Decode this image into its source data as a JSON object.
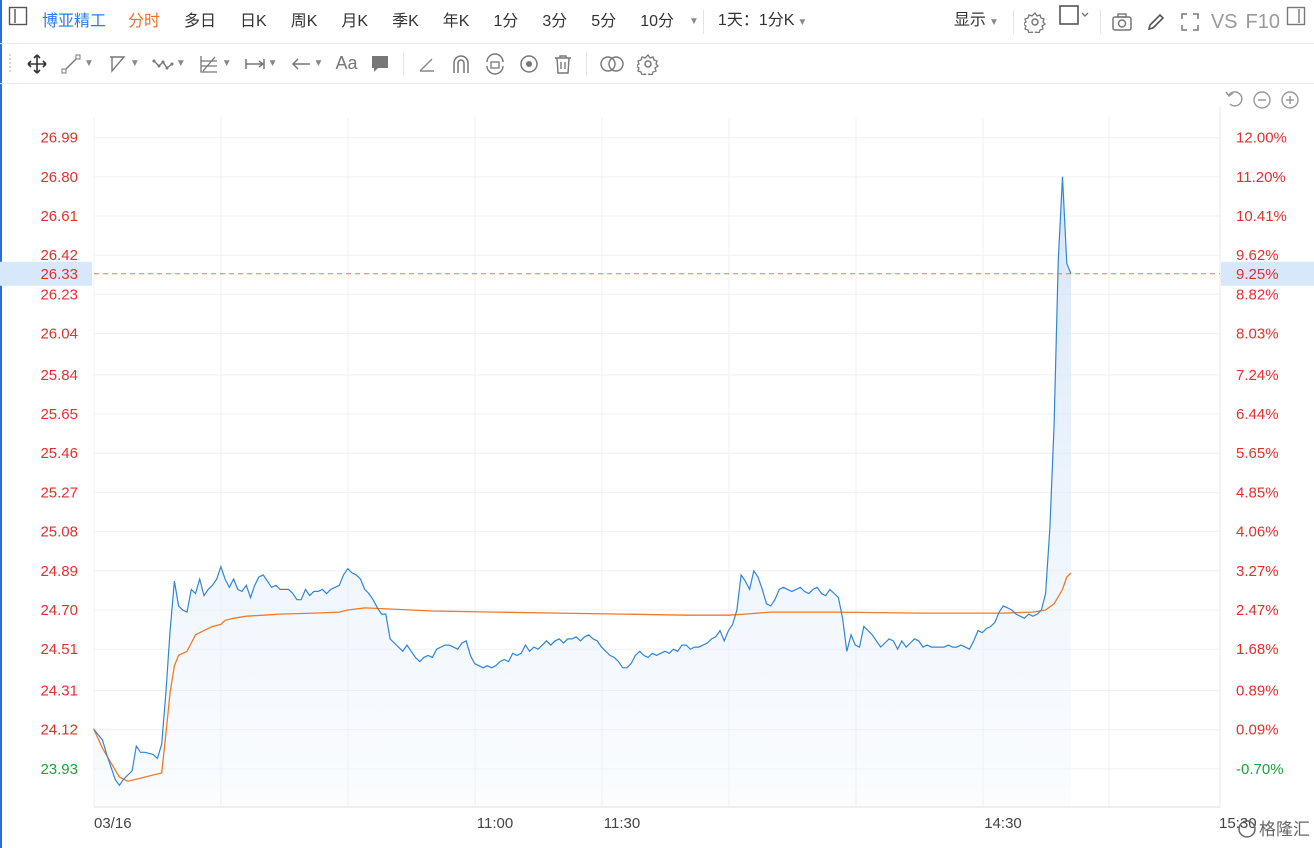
{
  "stock_name": "博亚精工",
  "period_tabs": [
    "分时",
    "多日",
    "日K",
    "周K",
    "月K",
    "季K",
    "年K",
    "1分",
    "3分",
    "5分",
    "10分"
  ],
  "active_tab": "分时",
  "interval_select": "1天：1分K",
  "display_label": "显示",
  "vs_label": "VS",
  "f10_label": "F10",
  "draw_tools": [
    "move-icon",
    "line-icon",
    "polyline-icon",
    "wave-icon",
    "fib-icon",
    "measure-icon",
    "arrow-icon",
    "text-tool-icon",
    "comment-icon",
    "pencil-icon",
    "magnet-icon",
    "lock-rotate-icon",
    "eye-icon",
    "trash-icon",
    "compare-icon",
    "settings-icon"
  ],
  "text_tool_label": "Aa",
  "colors": {
    "price_line": "#2f86d8",
    "avg_line": "#f07a28",
    "up": "#e5302f",
    "down": "#17a33b",
    "dashed": "#f07a28",
    "highlight": "#d7e8fb"
  },
  "watermark": "格隆汇",
  "chart_data": {
    "type": "area",
    "x_ticks": [
      "03/16",
      "11:00",
      "11:30",
      "14:30",
      "15:30"
    ],
    "y_left_ticks": [
      "26.99",
      "26.80",
      "26.61",
      "26.42",
      "26.23",
      "26.04",
      "25.84",
      "25.65",
      "25.46",
      "25.27",
      "25.08",
      "24.89",
      "24.70",
      "24.51",
      "24.31",
      "24.12",
      "23.93"
    ],
    "y_right_ticks": [
      "12.00%",
      "11.20%",
      "10.41%",
      "9.62%",
      "8.82%",
      "8.03%",
      "7.24%",
      "6.44%",
      "5.65%",
      "4.85%",
      "4.06%",
      "3.27%",
      "2.47%",
      "1.68%",
      "0.89%",
      "0.09%",
      "-0.70%"
    ],
    "tick_colors": [
      "up",
      "up",
      "up",
      "up",
      "up",
      "up",
      "up",
      "up",
      "up",
      "up",
      "up",
      "up",
      "up",
      "up",
      "up",
      "up",
      "down"
    ],
    "current_price": "26.33",
    "current_pct": "9.25%",
    "ylim": [
      23.745,
      27.09
    ],
    "x_range": [
      0,
      268
    ],
    "price_series": [
      [
        0,
        24.12
      ],
      [
        2,
        24.07
      ],
      [
        3,
        24.0
      ],
      [
        4,
        23.94
      ],
      [
        5,
        23.88
      ],
      [
        6,
        23.85
      ],
      [
        7,
        23.88
      ],
      [
        8,
        23.9
      ],
      [
        9,
        23.92
      ],
      [
        10,
        24.04
      ],
      [
        11,
        24.01
      ],
      [
        12,
        24.01
      ],
      [
        14,
        24.0
      ],
      [
        15,
        23.98
      ],
      [
        16,
        24.05
      ],
      [
        17,
        24.3
      ],
      [
        18,
        24.6
      ],
      [
        19,
        24.84
      ],
      [
        20,
        24.72
      ],
      [
        21,
        24.7
      ],
      [
        22,
        24.69
      ],
      [
        23,
        24.8
      ],
      [
        24,
        24.78
      ],
      [
        25,
        24.85
      ],
      [
        26,
        24.77
      ],
      [
        27,
        24.8
      ],
      [
        28,
        24.82
      ],
      [
        29,
        24.85
      ],
      [
        30,
        24.91
      ],
      [
        31,
        24.85
      ],
      [
        32,
        24.81
      ],
      [
        33,
        24.85
      ],
      [
        34,
        24.8
      ],
      [
        35,
        24.79
      ],
      [
        36,
        24.82
      ],
      [
        37,
        24.76
      ],
      [
        38,
        24.82
      ],
      [
        39,
        24.86
      ],
      [
        40,
        24.87
      ],
      [
        41,
        24.84
      ],
      [
        42,
        24.81
      ],
      [
        43,
        24.82
      ],
      [
        44,
        24.8
      ],
      [
        46,
        24.8
      ],
      [
        47,
        24.78
      ],
      [
        48,
        24.75
      ],
      [
        49,
        24.75
      ],
      [
        50,
        24.8
      ],
      [
        51,
        24.77
      ],
      [
        52,
        24.79
      ],
      [
        53,
        24.79
      ],
      [
        54,
        24.8
      ],
      [
        55,
        24.78
      ],
      [
        56,
        24.8
      ],
      [
        57,
        24.81
      ],
      [
        58,
        24.82
      ],
      [
        59,
        24.87
      ],
      [
        60,
        24.9
      ],
      [
        61,
        24.88
      ],
      [
        62,
        24.87
      ],
      [
        63,
        24.85
      ],
      [
        64,
        24.8
      ],
      [
        65,
        24.78
      ],
      [
        66,
        24.75
      ],
      [
        67,
        24.71
      ],
      [
        68,
        24.68
      ],
      [
        69,
        24.68
      ],
      [
        70,
        24.56
      ],
      [
        71,
        24.54
      ],
      [
        72,
        24.52
      ],
      [
        73,
        24.5
      ],
      [
        74,
        24.53
      ],
      [
        75,
        24.5
      ],
      [
        76,
        24.47
      ],
      [
        77,
        24.45
      ],
      [
        78,
        24.47
      ],
      [
        79,
        24.48
      ],
      [
        80,
        24.47
      ],
      [
        81,
        24.51
      ],
      [
        82,
        24.52
      ],
      [
        83,
        24.53
      ],
      [
        84,
        24.53
      ],
      [
        85,
        24.52
      ],
      [
        86,
        24.51
      ],
      [
        87,
        24.54
      ],
      [
        88,
        24.55
      ],
      [
        89,
        24.48
      ],
      [
        90,
        24.44
      ],
      [
        91,
        24.43
      ],
      [
        92,
        24.42
      ],
      [
        93,
        24.43
      ],
      [
        94,
        24.42
      ],
      [
        95,
        24.43
      ],
      [
        96,
        24.45
      ],
      [
        97,
        24.46
      ],
      [
        98,
        24.45
      ],
      [
        99,
        24.49
      ],
      [
        100,
        24.48
      ],
      [
        101,
        24.49
      ],
      [
        102,
        24.53
      ],
      [
        103,
        24.5
      ],
      [
        104,
        24.52
      ],
      [
        105,
        24.51
      ],
      [
        106,
        24.53
      ],
      [
        107,
        24.55
      ],
      [
        108,
        24.53
      ],
      [
        109,
        24.55
      ],
      [
        110,
        24.56
      ],
      [
        111,
        24.54
      ],
      [
        112,
        24.56
      ],
      [
        113,
        24.56
      ],
      [
        114,
        24.57
      ],
      [
        115,
        24.55
      ],
      [
        116,
        24.57
      ],
      [
        117,
        24.58
      ],
      [
        118,
        24.56
      ],
      [
        119,
        24.55
      ],
      [
        120,
        24.52
      ],
      [
        121,
        24.5
      ],
      [
        122,
        24.48
      ],
      [
        123,
        24.47
      ],
      [
        124,
        24.45
      ],
      [
        125,
        24.42
      ],
      [
        126,
        24.42
      ],
      [
        127,
        24.44
      ],
      [
        128,
        24.48
      ],
      [
        129,
        24.5
      ],
      [
        130,
        24.48
      ],
      [
        131,
        24.47
      ],
      [
        132,
        24.49
      ],
      [
        133,
        24.48
      ],
      [
        134,
        24.49
      ],
      [
        135,
        24.5
      ],
      [
        136,
        24.49
      ],
      [
        137,
        24.51
      ],
      [
        138,
        24.5
      ],
      [
        139,
        24.53
      ],
      [
        140,
        24.53
      ],
      [
        141,
        24.51
      ],
      [
        142,
        24.52
      ],
      [
        143,
        24.52
      ],
      [
        144,
        24.53
      ],
      [
        145,
        24.54
      ],
      [
        146,
        24.56
      ],
      [
        147,
        24.57
      ],
      [
        148,
        24.6
      ],
      [
        149,
        24.55
      ],
      [
        150,
        24.6
      ],
      [
        151,
        24.63
      ],
      [
        152,
        24.7
      ],
      [
        153,
        24.87
      ],
      [
        154,
        24.84
      ],
      [
        155,
        24.8
      ],
      [
        156,
        24.89
      ],
      [
        157,
        24.86
      ],
      [
        158,
        24.8
      ],
      [
        159,
        24.73
      ],
      [
        160,
        24.72
      ],
      [
        161,
        24.75
      ],
      [
        162,
        24.8
      ],
      [
        163,
        24.81
      ],
      [
        164,
        24.8
      ],
      [
        165,
        24.79
      ],
      [
        166,
        24.8
      ],
      [
        167,
        24.81
      ],
      [
        168,
        24.79
      ],
      [
        169,
        24.78
      ],
      [
        170,
        24.8
      ],
      [
        171,
        24.81
      ],
      [
        172,
        24.78
      ],
      [
        173,
        24.77
      ],
      [
        174,
        24.8
      ],
      [
        175,
        24.78
      ],
      [
        176,
        24.76
      ],
      [
        177,
        24.66
      ],
      [
        178,
        24.5
      ],
      [
        179,
        24.58
      ],
      [
        180,
        24.53
      ],
      [
        181,
        24.52
      ],
      [
        182,
        24.62
      ],
      [
        183,
        24.6
      ],
      [
        184,
        24.58
      ],
      [
        185,
        24.55
      ],
      [
        186,
        24.52
      ],
      [
        187,
        24.54
      ],
      [
        188,
        24.56
      ],
      [
        189,
        24.55
      ],
      [
        190,
        24.51
      ],
      [
        191,
        24.55
      ],
      [
        192,
        24.52
      ],
      [
        193,
        24.54
      ],
      [
        194,
        24.56
      ],
      [
        195,
        24.55
      ],
      [
        196,
        24.52
      ],
      [
        197,
        24.53
      ],
      [
        198,
        24.52
      ],
      [
        199,
        24.52
      ],
      [
        201,
        24.52
      ],
      [
        202,
        24.53
      ],
      [
        203,
        24.52
      ],
      [
        204,
        24.52
      ],
      [
        205,
        24.53
      ],
      [
        206,
        24.52
      ],
      [
        207,
        24.51
      ],
      [
        208,
        24.55
      ],
      [
        209,
        24.6
      ],
      [
        210,
        24.59
      ],
      [
        211,
        24.61
      ],
      [
        212,
        24.62
      ],
      [
        213,
        24.64
      ],
      [
        214,
        24.69
      ],
      [
        215,
        24.72
      ],
      [
        216,
        24.71
      ],
      [
        217,
        24.7
      ],
      [
        218,
        24.68
      ],
      [
        219,
        24.67
      ],
      [
        220,
        24.66
      ],
      [
        221,
        24.68
      ],
      [
        222,
        24.67
      ],
      [
        223,
        24.68
      ],
      [
        224,
        24.7
      ],
      [
        225,
        24.78
      ],
      [
        226,
        25.1
      ],
      [
        227,
        25.6
      ],
      [
        228,
        26.4
      ],
      [
        229,
        26.8
      ],
      [
        230,
        26.38
      ],
      [
        231,
        26.33
      ]
    ],
    "avg_series": [
      [
        0,
        24.12
      ],
      [
        2,
        24.03
      ],
      [
        4,
        23.96
      ],
      [
        6,
        23.89
      ],
      [
        8,
        23.87
      ],
      [
        10,
        23.88
      ],
      [
        14,
        23.9
      ],
      [
        16,
        23.91
      ],
      [
        17,
        24.1
      ],
      [
        18,
        24.3
      ],
      [
        19,
        24.43
      ],
      [
        20,
        24.48
      ],
      [
        22,
        24.5
      ],
      [
        23,
        24.54
      ],
      [
        24,
        24.58
      ],
      [
        26,
        24.6
      ],
      [
        28,
        24.62
      ],
      [
        30,
        24.63
      ],
      [
        31,
        24.65
      ],
      [
        33,
        24.66
      ],
      [
        36,
        24.67
      ],
      [
        40,
        24.675
      ],
      [
        44,
        24.68
      ],
      [
        52,
        24.685
      ],
      [
        58,
        24.69
      ],
      [
        60,
        24.7
      ],
      [
        64,
        24.71
      ],
      [
        70,
        24.705
      ],
      [
        80,
        24.695
      ],
      [
        95,
        24.69
      ],
      [
        110,
        24.685
      ],
      [
        125,
        24.68
      ],
      [
        140,
        24.675
      ],
      [
        150,
        24.675
      ],
      [
        154,
        24.68
      ],
      [
        160,
        24.69
      ],
      [
        175,
        24.69
      ],
      [
        195,
        24.685
      ],
      [
        215,
        24.685
      ],
      [
        222,
        24.69
      ],
      [
        225,
        24.7
      ],
      [
        227,
        24.73
      ],
      [
        229,
        24.8
      ],
      [
        230,
        24.86
      ],
      [
        231,
        24.88
      ]
    ]
  }
}
